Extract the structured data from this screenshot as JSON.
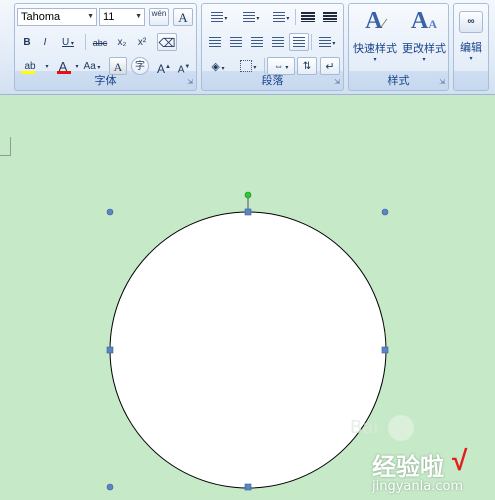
{
  "font_group": {
    "label": "字体",
    "font_name": "Tahoma",
    "font_size": "11",
    "bold": "B",
    "italic": "I",
    "underline": "U",
    "strikethrough": "abc",
    "subscript": "x₂",
    "superscript": "x²",
    "change_case": "Aa",
    "grow_font": "A",
    "shrink_font": "A",
    "phonetic": "wén",
    "clear_format": "A",
    "char_shading": "A",
    "enclose": "字"
  },
  "paragraph_group": {
    "label": "段落"
  },
  "styles_group": {
    "label": "样式",
    "quick_styles": "快速样式",
    "change_styles": "更改样式"
  },
  "editing_group": {
    "label": "编辑"
  },
  "colors": {
    "font_color_bar": "#e81010",
    "highlight_bar": "#ffff00",
    "canvas": "#c6e9c8",
    "handle": "#5b86c5",
    "rotate_handle": "#22cc33"
  },
  "watermark": {
    "brand": "Bai",
    "site": "经验啦",
    "url": "jingyanla.com"
  }
}
